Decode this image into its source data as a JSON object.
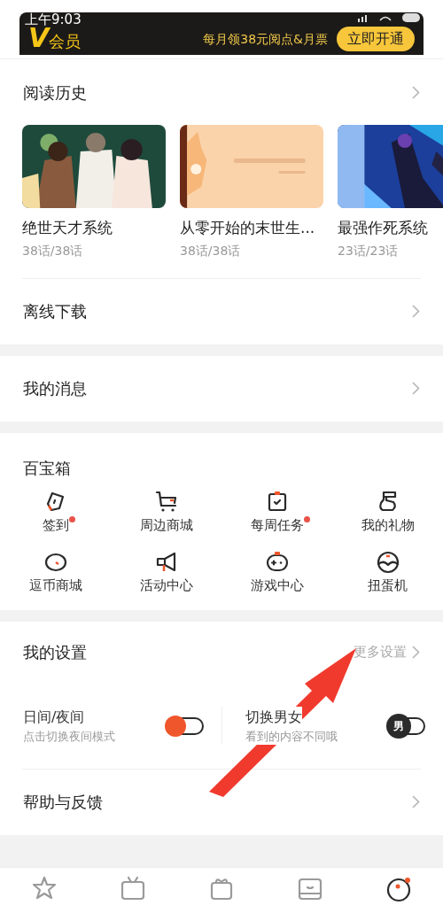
{
  "status_bar": {
    "time": "上午9:03"
  },
  "vip_banner": {
    "logo": "V",
    "logo_text": "会员",
    "promo": "每月领38元阅点&月票",
    "button": "立即开通"
  },
  "reading_history": {
    "title": "阅读历史",
    "items": [
      {
        "title": "绝世天才系统",
        "progress": "38话/38话"
      },
      {
        "title": "从零开始的末世生...",
        "progress": "38话/38话"
      },
      {
        "title": "最强作死系统",
        "progress": "23话/23话"
      }
    ]
  },
  "offline_download": {
    "title": "离线下载"
  },
  "messages": {
    "title": "我的消息"
  },
  "toolbox": {
    "title": "百宝箱",
    "items": [
      {
        "label": "签到",
        "kind": "pen",
        "badge": true
      },
      {
        "label": "周边商城",
        "kind": "cart",
        "badge": false
      },
      {
        "label": "每周任务",
        "kind": "task",
        "badge": true
      },
      {
        "label": "我的礼物",
        "kind": "sock",
        "badge": false
      },
      {
        "label": "逗币商城",
        "kind": "bean",
        "badge": false
      },
      {
        "label": "活动中心",
        "kind": "megaphone",
        "badge": false
      },
      {
        "label": "游戏中心",
        "kind": "gamepad",
        "badge": false
      },
      {
        "label": "扭蛋机",
        "kind": "egg",
        "badge": false
      }
    ]
  },
  "settings": {
    "title": "我的设置",
    "more": "更多设置",
    "toggles": [
      {
        "title": "日间/夜间",
        "subtitle": "点击切换夜间模式",
        "kind": "sun",
        "on": false
      },
      {
        "title": "切换男女",
        "subtitle": "看到的内容不同哦",
        "kind": "gender",
        "knob_text": "男",
        "on": false
      }
    ]
  },
  "help": {
    "title": "帮助与反馈"
  },
  "bottom_nav": [
    {
      "kind": "star",
      "selected": false
    },
    {
      "kind": "tv",
      "selected": false
    },
    {
      "kind": "gift",
      "selected": false
    },
    {
      "kind": "shelf",
      "selected": false
    },
    {
      "kind": "face",
      "selected": true
    }
  ]
}
